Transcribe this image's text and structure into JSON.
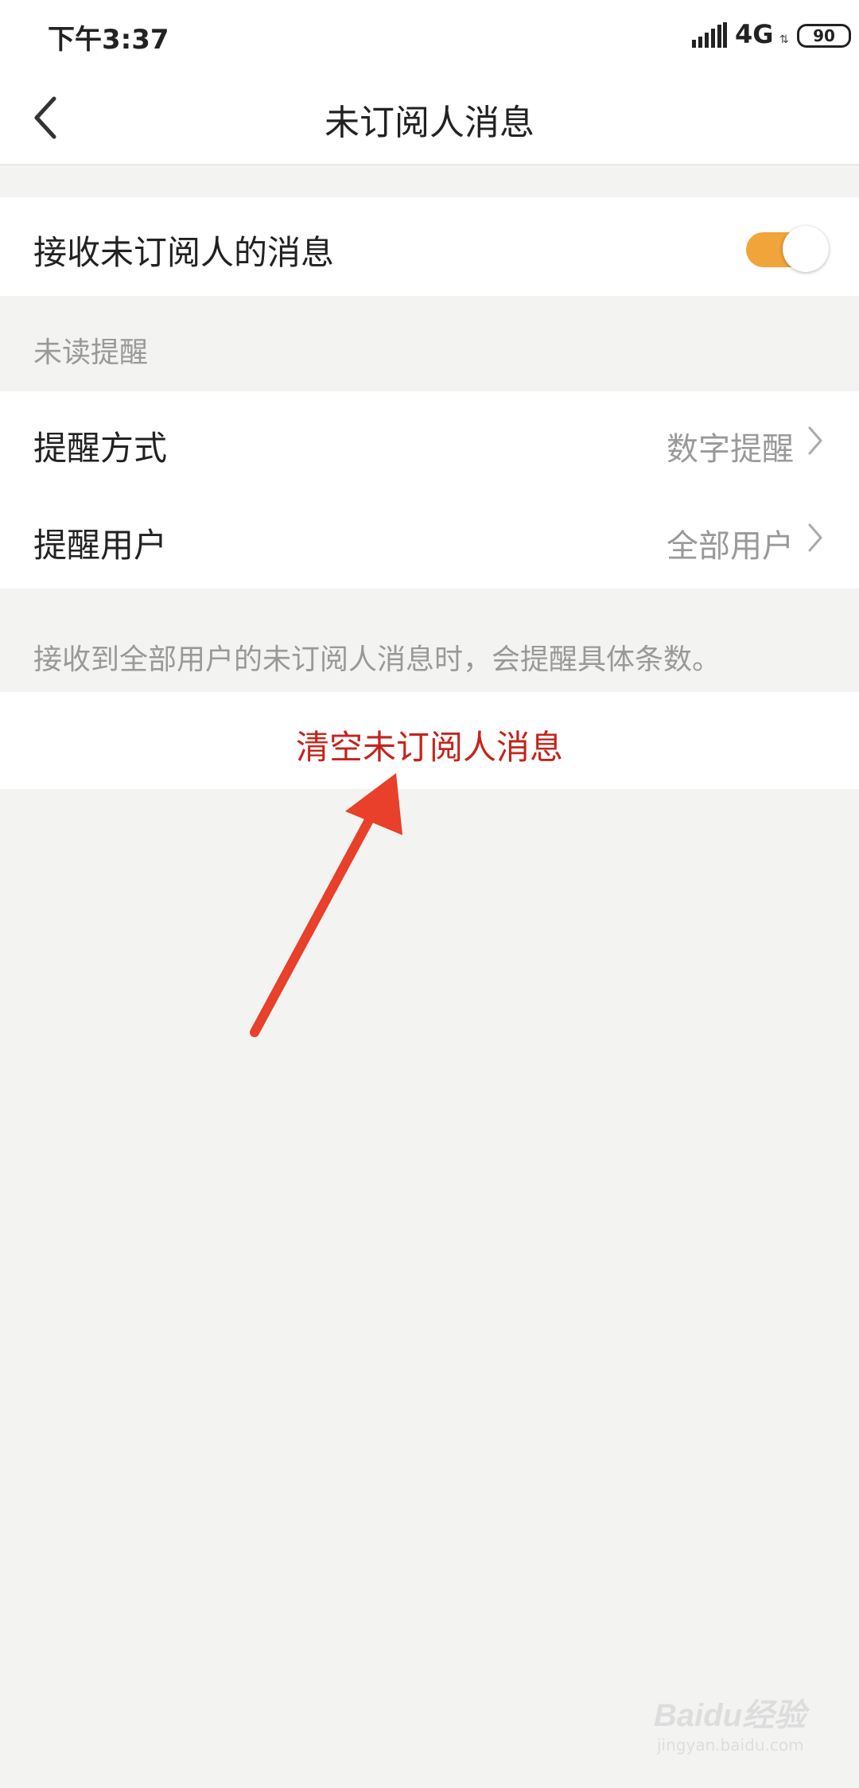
{
  "status_bar": {
    "time": "下午3:37",
    "network": "4G",
    "network_arrows": "⇅",
    "battery": "90"
  },
  "nav": {
    "title": "未订阅人消息"
  },
  "receive_row": {
    "label": "接收未订阅人的消息",
    "toggle_on": true,
    "toggle_color": "#f0a43a"
  },
  "unread_section": {
    "header": "未读提醒",
    "items": [
      {
        "label": "提醒方式",
        "value": "数字提醒"
      },
      {
        "label": "提醒用户",
        "value": "全部用户"
      }
    ]
  },
  "hint": "接收到全部用户的未订阅人消息时，会提醒具体条数。",
  "clear_button": {
    "label": "清空未订阅人消息",
    "color": "#c4241c"
  },
  "annotation": {
    "arrow_color": "#e8402a"
  },
  "watermark": {
    "main": "Baidu经验",
    "sub": "jingyan.baidu.com"
  }
}
